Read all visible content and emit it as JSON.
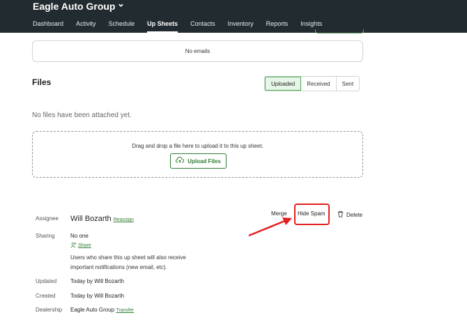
{
  "app": {
    "org_name": "Eagle Auto Group",
    "nav": [
      "Dashboard",
      "Activity",
      "Schedule",
      "Up Sheets",
      "Contacts",
      "Inventory",
      "Reports",
      "Insights"
    ],
    "active_nav": "Up Sheets"
  },
  "emails": {
    "empty_text": "No emails"
  },
  "files": {
    "title": "Files",
    "tabs": [
      "Uploaded",
      "Received",
      "Sent"
    ],
    "active_tab": "Uploaded",
    "empty_text": "No files have been attached yet.",
    "drop_text": "Drag and drop a file here to upload it to this up sheet.",
    "upload_label": "Upload Files"
  },
  "details": {
    "assignee_label": "Assignee",
    "assignee_name": "Will Bozarth",
    "reassign_label": "Reassign",
    "sharing_label": "Sharing",
    "sharing_value": "No one",
    "share_label": "Share",
    "sharing_note": "Users who share this up sheet will also receive important notifications (new email, etc).",
    "updated_label": "Updated",
    "updated_value": "Today by Will Bozarth",
    "created_label": "Created",
    "created_value": "Today by Will Bozarth",
    "dealership_label": "Dealership",
    "dealership_value": "Eagle Auto Group",
    "transfer_label": "Transfer"
  },
  "actions": {
    "merge_label": "Merge",
    "hide_spam_label": "Hide Spam",
    "delete_label": "Delete"
  },
  "annotation": {
    "highlight_color": "#e21e1e"
  },
  "icons": {
    "brand_dropdown": "chevron-down-icon",
    "upload": "cloud-upload-icon",
    "share": "person-add-icon",
    "delete": "trash-icon"
  }
}
